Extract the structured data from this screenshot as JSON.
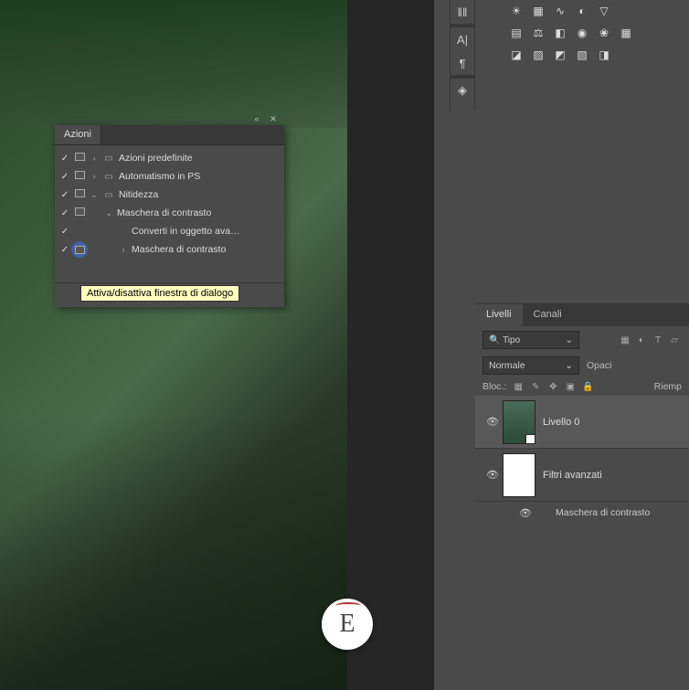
{
  "actions_panel": {
    "tab": "Azioni",
    "tooltip": "Attiva/disattiva finestra di dialogo",
    "rows": [
      {
        "check": true,
        "dialog": true,
        "arrow": "›",
        "folder": true,
        "label": "Azioni predefinite",
        "indent": 0
      },
      {
        "check": true,
        "dialog": true,
        "arrow": "›",
        "folder": true,
        "label": "Automatismo in PS",
        "indent": 0
      },
      {
        "check": true,
        "dialog": true,
        "arrow": "⌄",
        "folder": true,
        "label": "Nitidezza",
        "indent": 0
      },
      {
        "check": true,
        "dialog": true,
        "arrow": "⌄",
        "folder": false,
        "label": "Maschera di contrasto",
        "indent": 1
      },
      {
        "check": true,
        "dialog": false,
        "arrow": "",
        "folder": false,
        "label": "Converti in oggetto ava…",
        "indent": 2
      },
      {
        "check": true,
        "dialog": true,
        "arrow": "›",
        "folder": false,
        "label": "Maschera di contrasto",
        "indent": 2,
        "highlight": true
      }
    ]
  },
  "layers_panel": {
    "tabs": {
      "livelli": "Livelli",
      "canali": "Canali"
    },
    "filter_label": "Tipo",
    "blend_mode": "Normale",
    "opacity_label": "Opaci",
    "lock_label": "Bloc.:",
    "fill_label": "Riemp",
    "layer0": "Livello 0",
    "smart_filters": "Filtri avanzati",
    "filter_name": "Maschera di contrasto"
  },
  "logo": {
    "letter": "E"
  }
}
